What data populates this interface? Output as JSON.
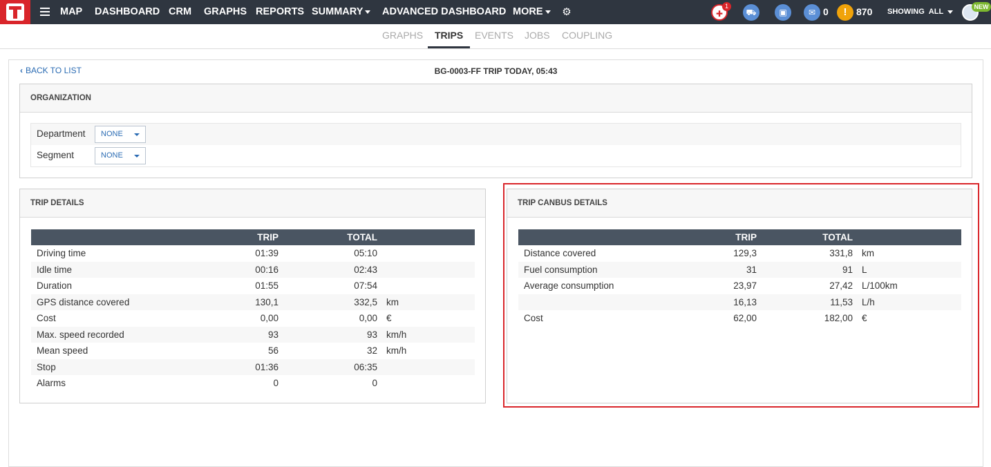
{
  "topbar": {
    "nav": [
      {
        "label": "MAP"
      },
      {
        "label": "DASHBOARD"
      },
      {
        "label": "CRM"
      },
      {
        "label": "GRAPHS"
      },
      {
        "label": "REPORTS"
      },
      {
        "label": "SUMMARY",
        "has_caret": true
      },
      {
        "label": "ADVANCED DASHBOARD"
      },
      {
        "label": "MORE",
        "has_caret": true
      }
    ],
    "notification_badge": "1",
    "messages_count": "0",
    "alerts_count": "870",
    "showing_label": "SHOWING",
    "showing_value": "ALL",
    "new_badge": "NEW"
  },
  "subnav": {
    "tabs": [
      {
        "label": "GRAPHS",
        "active": false
      },
      {
        "label": "TRIPS",
        "active": true
      },
      {
        "label": "EVENTS",
        "active": false
      },
      {
        "label": "JOBS",
        "active": false
      },
      {
        "label": "COUPLING",
        "active": false
      }
    ]
  },
  "page": {
    "back_label": "BACK TO LIST",
    "title": "BG-0003-FF TRIP TODAY, 05:43"
  },
  "organization": {
    "heading": "ORGANIZATION",
    "department_label": "Department",
    "department_value": "NONE",
    "segment_label": "Segment",
    "segment_value": "NONE"
  },
  "trip_details": {
    "heading": "TRIP DETAILS",
    "col_trip": "TRIP",
    "col_total": "TOTAL",
    "rows": [
      {
        "label": "Driving time",
        "trip": "01:39",
        "total": "05:10",
        "unit": ""
      },
      {
        "label": "Idle time",
        "trip": "00:16",
        "total": "02:43",
        "unit": ""
      },
      {
        "label": "Duration",
        "trip": "01:55",
        "total": "07:54",
        "unit": ""
      },
      {
        "label": "GPS distance covered",
        "trip": "130,1",
        "total": "332,5",
        "unit": "km"
      },
      {
        "label": "Cost",
        "trip": "0,00",
        "total": "0,00",
        "unit": "€"
      },
      {
        "label": "Max. speed recorded",
        "trip": "93",
        "total": "93",
        "unit": "km/h"
      },
      {
        "label": "Mean speed",
        "trip": "56",
        "total": "32",
        "unit": "km/h"
      },
      {
        "label": "Stop",
        "trip": "01:36",
        "total": "06:35",
        "unit": ""
      },
      {
        "label": "Alarms",
        "trip": "0",
        "total": "0",
        "unit": ""
      }
    ]
  },
  "canbus_details": {
    "heading": "TRIP CANBUS DETAILS",
    "col_trip": "TRIP",
    "col_total": "TOTAL",
    "rows": [
      {
        "label": "Distance covered",
        "trip": "129,3",
        "total": "331,8",
        "unit": "km"
      },
      {
        "label": "Fuel consumption",
        "trip": "31",
        "total": "91",
        "unit": "L"
      },
      {
        "label": "Average consumption",
        "trip": "23,97",
        "total": "27,42",
        "unit": "L/100km"
      },
      {
        "label": "",
        "trip": "16,13",
        "total": "11,53",
        "unit": "L/h"
      },
      {
        "label": "Cost",
        "trip": "62,00",
        "total": "182,00",
        "unit": "€"
      }
    ]
  },
  "colors": {
    "topbar": "#2f3640",
    "brand_red": "#d9252a",
    "table_header": "#4a5562",
    "link_blue": "#2a6bb3"
  }
}
